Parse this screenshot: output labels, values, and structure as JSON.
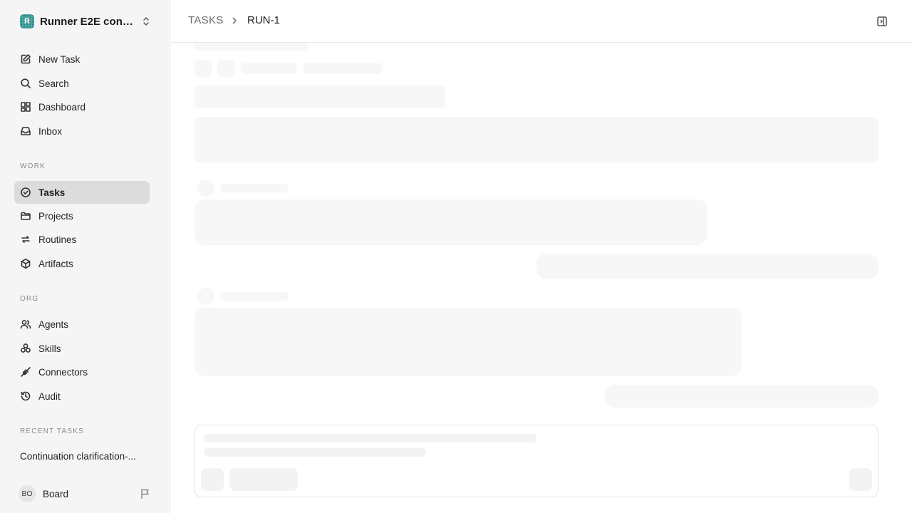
{
  "workspace": {
    "logo_letter": "R",
    "name": "Runner E2E conti..."
  },
  "nav": {
    "new_task": "New Task",
    "search": "Search",
    "dashboard": "Dashboard",
    "inbox": "Inbox"
  },
  "sections": {
    "work": "WORK",
    "org": "ORG",
    "recent": "RECENT TASKS"
  },
  "work_items": {
    "tasks": "Tasks",
    "projects": "Projects",
    "routines": "Routines",
    "artifacts": "Artifacts"
  },
  "org_items": {
    "agents": "Agents",
    "skills": "Skills",
    "connectors": "Connectors",
    "audit": "Audit"
  },
  "recent_tasks": [
    "Continuation clarification-..."
  ],
  "user": {
    "initials": "BO",
    "name": "Board"
  },
  "breadcrumb": {
    "parent": "TASKS",
    "current": "RUN-1"
  },
  "colors": {
    "active_nav_bg": "#dcdcdc",
    "sidebar_bg": "#f5f5f5",
    "skeleton": "#f7f7f7"
  }
}
